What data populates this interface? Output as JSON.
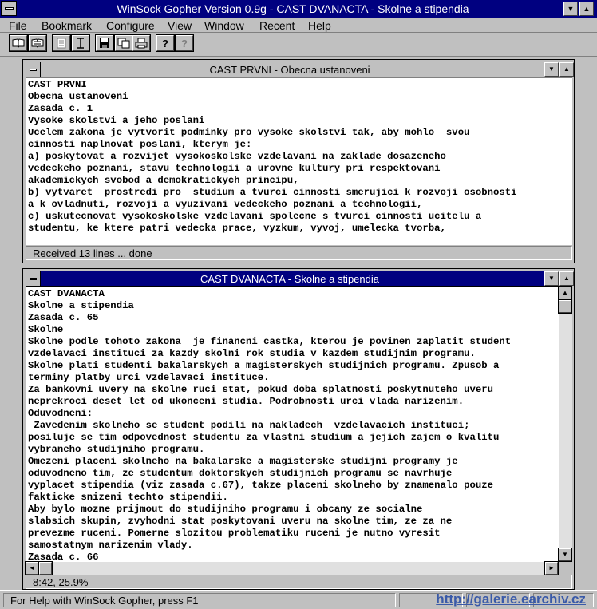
{
  "window": {
    "title": "WinSock Gopher Version 0.9g - CAST DVANACTA - Skolne a stipendia"
  },
  "menu": [
    {
      "label": "File"
    },
    {
      "label": "Bookmark"
    },
    {
      "label": "Configure"
    },
    {
      "label": "View"
    },
    {
      "label": "Window"
    },
    {
      "label": "Recent"
    },
    {
      "label": "Help"
    }
  ],
  "toolbar": {
    "buttons": [
      {
        "icon": "open-book-icon"
      },
      {
        "icon": "bookmark-book-icon"
      },
      {
        "icon": "page-icon"
      },
      {
        "icon": "text-cursor-icon"
      },
      {
        "icon": "save-icon"
      },
      {
        "icon": "copy-icon"
      },
      {
        "icon": "print-icon"
      },
      {
        "icon": "help-icon"
      },
      {
        "icon": "context-help-icon"
      }
    ]
  },
  "window1": {
    "title": "CAST PRVNI - Obecna ustanoveni",
    "lines": [
      "CAST PRVNI",
      "Obecna ustanoveni",
      "Zasada c. 1",
      "Vysoke skolstvi a jeho poslani",
      "Ucelem zakona je vytvorit podminky pro vysoke skolstvi tak, aby mohlo  svou",
      "cinnosti naplnovat poslani, kterym je:",
      "a) poskytovat a rozvijet vysokoskolske vzdelavani na zaklade dosazeneho",
      "vedeckeho poznani, stavu technologii a urovne kultury pri respektovani",
      "akademickych svobod a demokratickych principu,",
      "b) vytvaret  prostredi pro  studium a tvurci cinnosti smerujici k rozvoji osobnosti",
      "a k ovladnuti, rozvoji a vyuzivani vedeckeho poznani a technologii,",
      "c) uskutecnovat vysokoskolske vzdelavani spolecne s tvurci cinnosti ucitelu a",
      "studentu, ke ktere patri vedecka prace, vyzkum, vyvoj, umelecka tvorba,"
    ],
    "status": "Received 13 lines ... done"
  },
  "window2": {
    "title": "CAST DVANACTA - Skolne a stipendia",
    "lines": [
      "CAST DVANACTA",
      "Skolne a stipendia",
      "Zasada c. 65",
      "Skolne",
      "Skolne podle tohoto zakona  je financni castka, kterou je povinen zaplatit student",
      "vzdelavaci instituci za kazdy skolni rok studia v kazdem studijnim programu.",
      "Skolne plati studenti bakalarskych a magisterskych studijnich programu. Zpusob a",
      "terminy platby urci vzdelavaci instituce.",
      "Za bankovni uvery na skolne ruci stat, pokud doba splatnosti poskytnuteho uveru",
      "neprekroci deset let od ukonceni studia. Podrobnosti urci vlada narizenim.",
      "Oduvodneni:",
      " Zavedenim skolneho se student podili na nakladech  vzdelavacich instituci;",
      "posiluje se tim odpovednost studentu za vlastni studium a jejich zajem o kvalitu",
      "vybraneho studijniho programu.",
      "Omezeni placeni skolneho na bakalarske a magisterske studijni programy je",
      "oduvodneno tim, ze studentum doktorskych studijnich programu se navrhuje",
      "vyplacet stipendia (viz zasada c.67), takze placeni skolneho by znamenalo pouze",
      "fakticke snizeni techto stipendii.",
      "Aby bylo mozne prijmout do studijniho programu i obcany ze socialne",
      "slabsich skupin, zvyhodni stat poskytovani uveru na skolne tim, ze za ne",
      "prevezme ruceni. Pomerne slozitou problematiku ruceni je nutno vyresit",
      "samostatnym narizenim vlady.",
      "Zasada c. 66"
    ],
    "status": "8:42, 25.9%"
  },
  "statusbar": {
    "help": "For Help with WinSock Gopher, press F1",
    "watermark": "http://galerie.earchiv.cz"
  }
}
